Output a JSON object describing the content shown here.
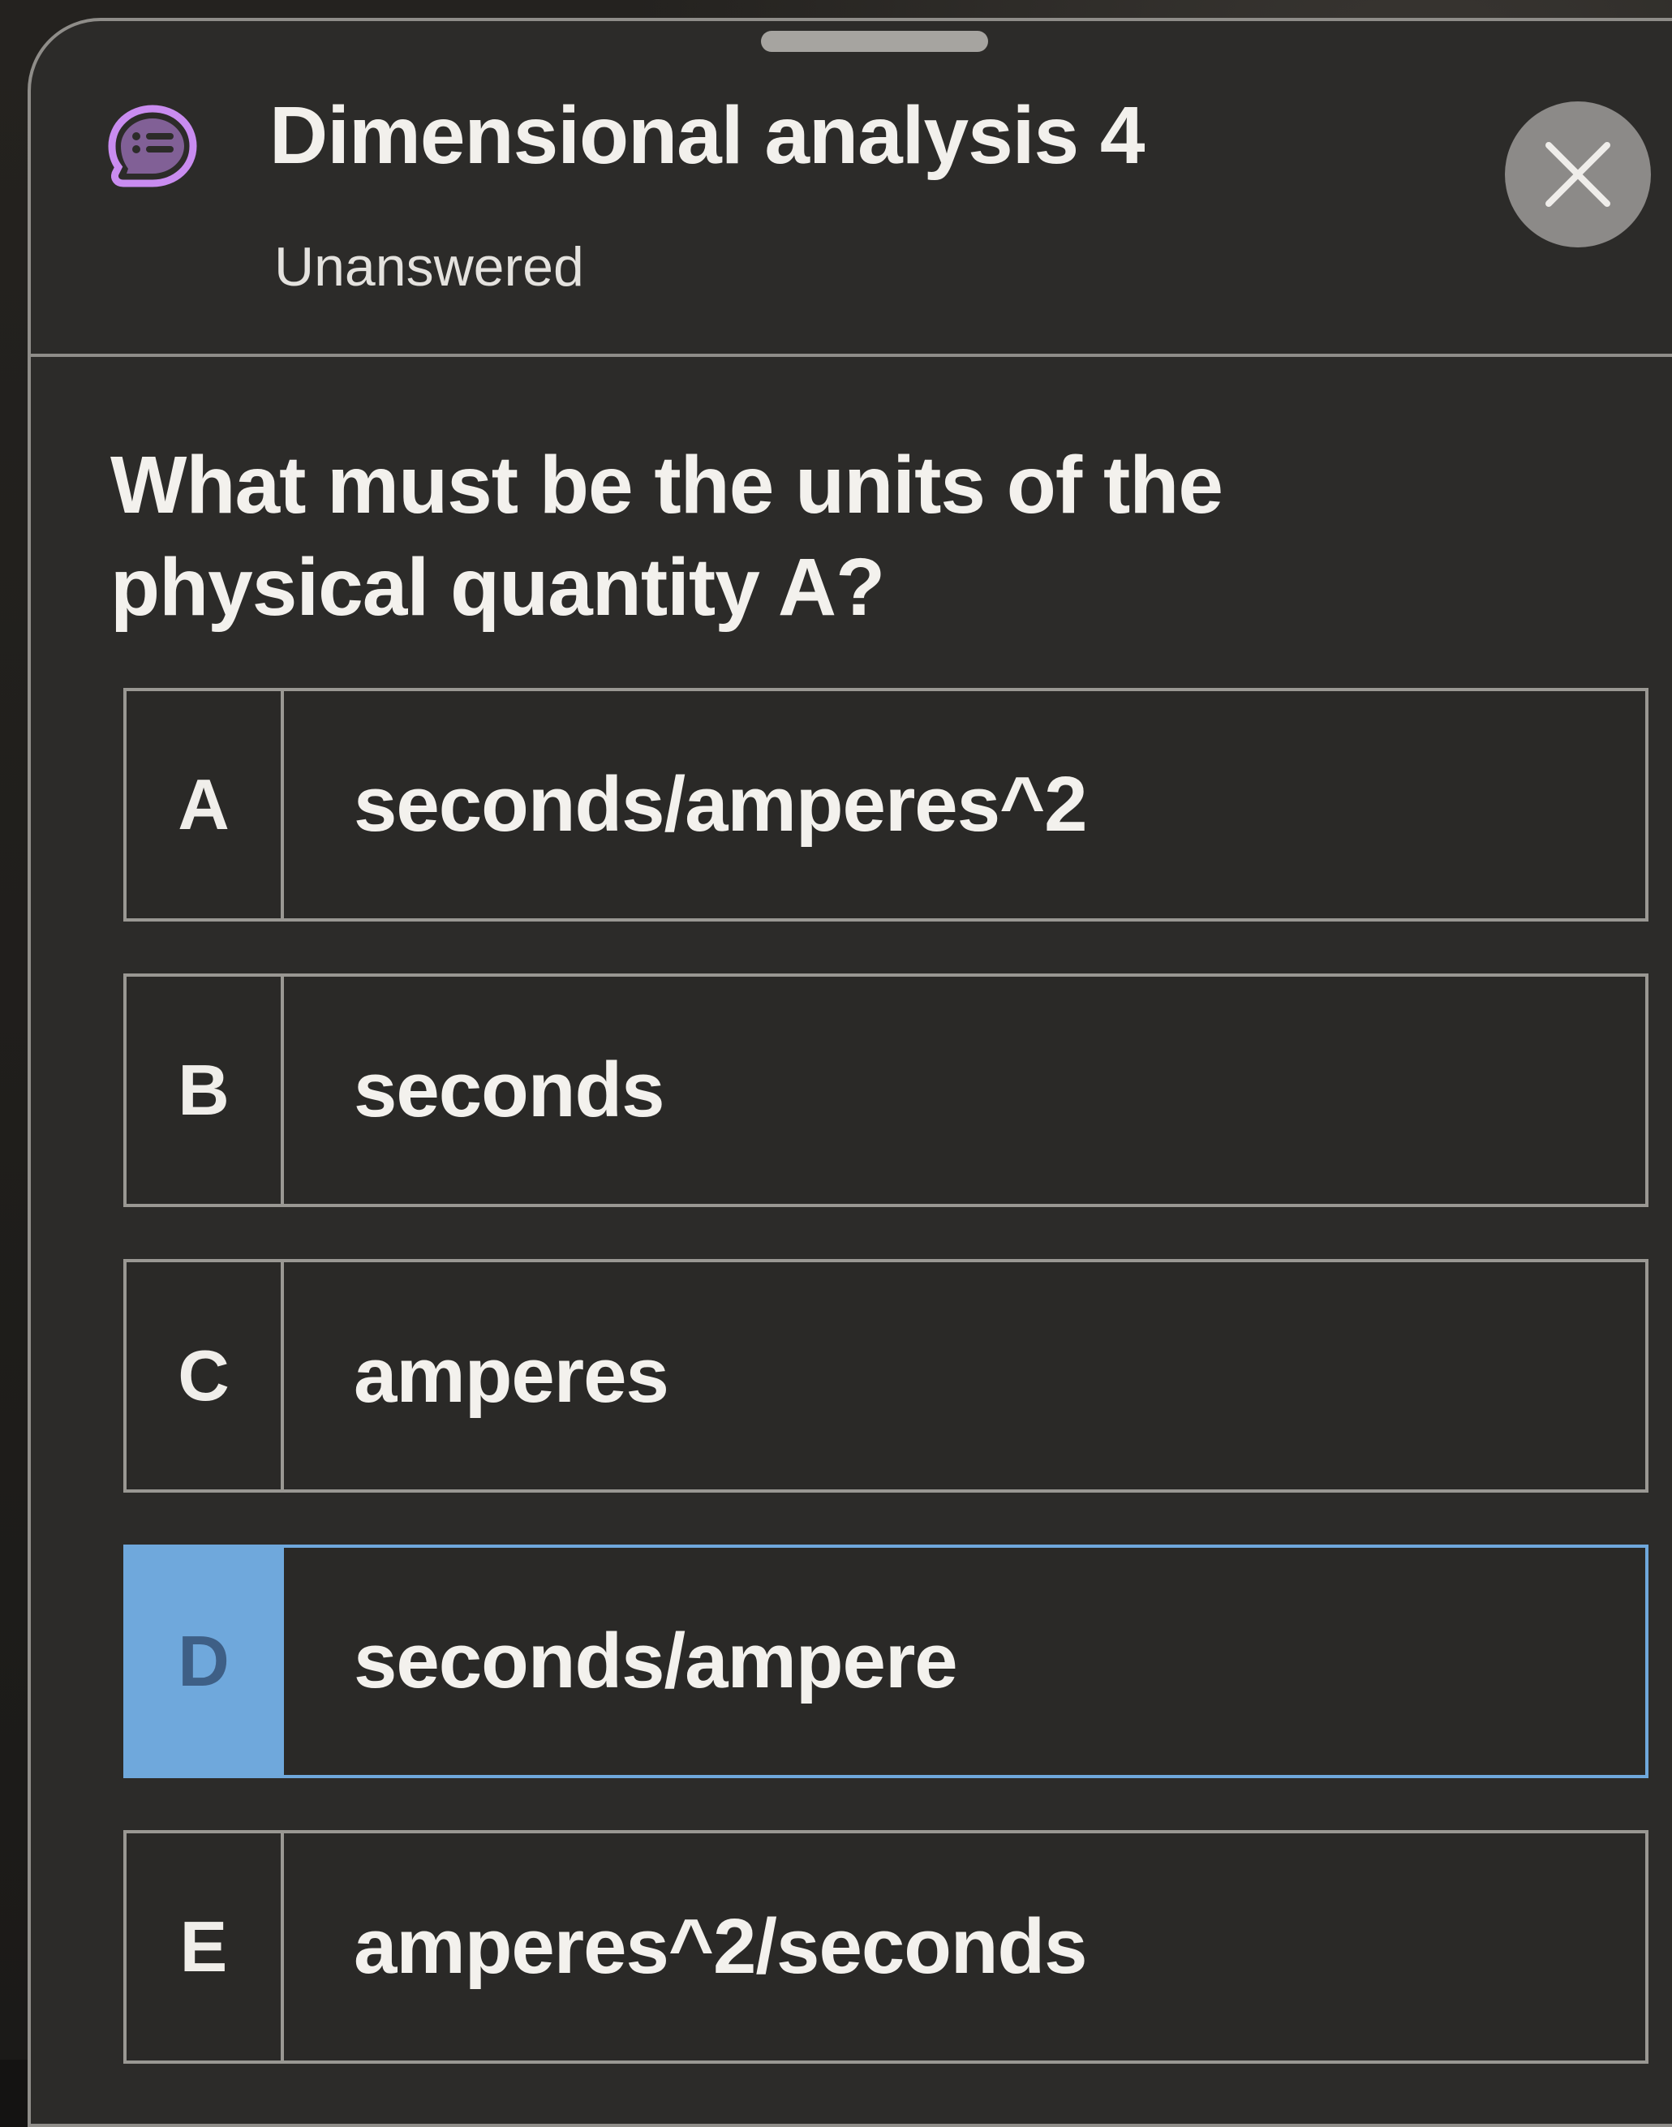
{
  "header": {
    "title": "Dimensional analysis 4",
    "status": "Unanswered",
    "icon": "quiz-list-icon",
    "close_icon": "close-icon"
  },
  "question": {
    "text": "What must be the units of the physical quantity A?"
  },
  "options": [
    {
      "letter": "A",
      "text": "seconds/amperes^2",
      "selected": false
    },
    {
      "letter": "B",
      "text": "seconds",
      "selected": false
    },
    {
      "letter": "C",
      "text": "amperes",
      "selected": false
    },
    {
      "letter": "D",
      "text": "seconds/ampere",
      "selected": true
    },
    {
      "letter": "E",
      "text": "amperes^2/seconds",
      "selected": false
    }
  ],
  "colors": {
    "accent": "#6fa8dc",
    "icon_purple": "#c98cf0",
    "sheet_bg": "#2c2b29",
    "border": "#9a9893"
  }
}
